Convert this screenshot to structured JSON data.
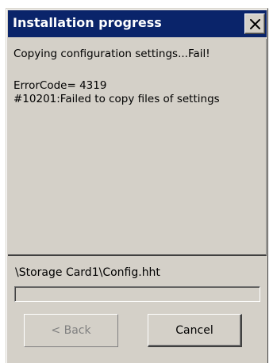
{
  "window": {
    "title": "Installation progress",
    "title_bar_color": "#0a246a",
    "close_icon": "close-x-icon"
  },
  "log": {
    "lines": [
      "Copying configuration settings...Fail!",
      "",
      "ErrorCode= 4319",
      "#10201:Failed to copy files of settings"
    ]
  },
  "status": {
    "current_file": "\\Storage Card1\\Config.hht",
    "progress_fraction": 0.0
  },
  "buttons": {
    "back_label": "< Back",
    "back_enabled": false,
    "cancel_label": "Cancel",
    "cancel_enabled": true
  }
}
